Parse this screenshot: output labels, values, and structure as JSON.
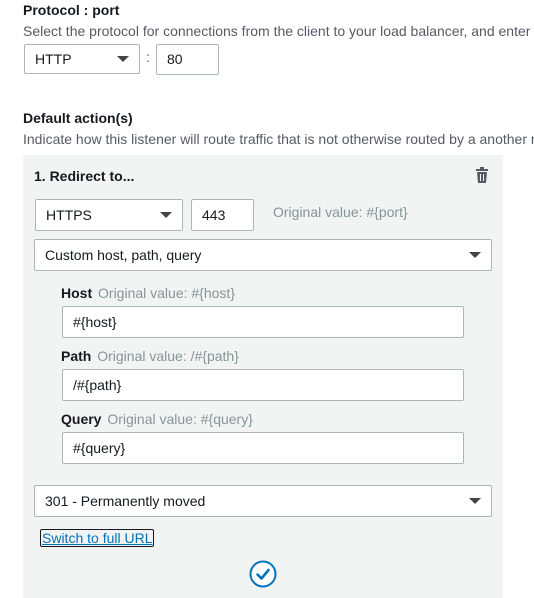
{
  "protocol_port": {
    "title": "Protocol : port",
    "description": "Select the protocol for connections from the client to your load balancer, and enter",
    "protocol_value": "HTTP",
    "separator": ":",
    "port_value": "80"
  },
  "default_actions": {
    "title": "Default action(s)",
    "description": "Indicate how this listener will route traffic that is not otherwise routed by a another r"
  },
  "action": {
    "heading": "1. Redirect to...",
    "protocol_value": "HTTPS",
    "port_value": "443",
    "port_hint": "Original value: #{port}",
    "redirect_mode_value": "Custom host, path, query",
    "host": {
      "label": "Host",
      "hint": "Original value: #{host}",
      "value": "#{host}"
    },
    "path": {
      "label": "Path",
      "hint": "Original value: /#{path}",
      "value": "/#{path}"
    },
    "query": {
      "label": "Query",
      "hint": "Original value: #{query}",
      "value": "#{query}"
    },
    "status_code_value": "301 - Permanently moved",
    "switch_link": "Switch to full URL"
  }
}
